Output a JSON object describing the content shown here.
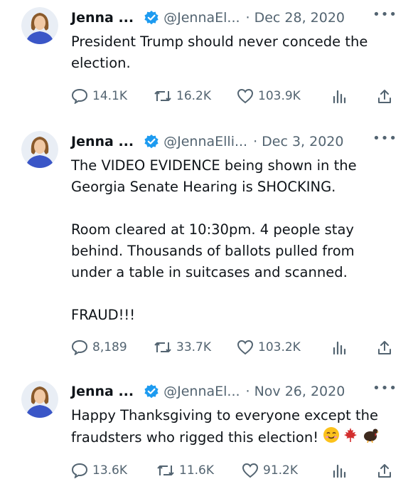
{
  "tweets": [
    {
      "name": "Jenna ...",
      "handle": "@JennaEl...",
      "separator": "·",
      "date": "Dec 28, 2020",
      "more": "•••",
      "text": [
        "President Trump should never concede the election."
      ],
      "replies": "14.1K",
      "retweets": "16.2K",
      "likes": "103.9K"
    },
    {
      "name": "Jenna ...",
      "handle": "@JennaElli...",
      "separator": "·",
      "date": "Dec 3, 2020",
      "more": "•••",
      "text": [
        "The VIDEO EVIDENCE being shown in the Georgia Senate Hearing is SHOCKING.",
        "Room cleared at 10:30pm. 4 people stay behind. Thousands of ballots pulled from under a table in suitcases and scanned.",
        "FRAUD!!!"
      ],
      "replies": "8,189",
      "retweets": "33.7K",
      "likes": "103.2K"
    },
    {
      "name": "Jenna ...",
      "handle": "@JennaEl...",
      "separator": "·",
      "date": "Nov 26, 2020",
      "more": "•••",
      "text": [
        "Happy Thanksgiving to everyone except the fraudsters who rigged this election!"
      ],
      "replies": "13.6K",
      "retweets": "11.6K",
      "likes": "91.2K"
    }
  ],
  "colors": {
    "verified": "#1d9bf0",
    "muted": "#536471",
    "avatar_bg": "#3a56c7"
  },
  "icons": [
    "verified-badge-icon",
    "reply-icon",
    "retweet-icon",
    "like-icon",
    "views-icon",
    "share-icon",
    "smiling-face-emoji",
    "maple-leaf-emoji",
    "turkey-emoji"
  ]
}
